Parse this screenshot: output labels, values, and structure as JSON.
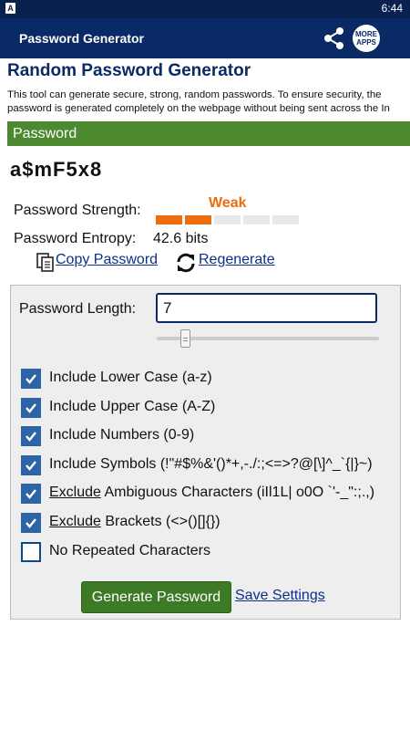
{
  "status_bar": {
    "app_badge": "A",
    "time": "6:44"
  },
  "app_bar": {
    "title": "Password Generator",
    "share_icon": "share-icon",
    "more_apps_label_line1": "MORE",
    "more_apps_label_line2": "APPS"
  },
  "page": {
    "title": "Random Password Generator",
    "intro_line1": "This tool can generate secure, strong, random passwords. To ensure security, the",
    "intro_line2": "password is generated completely on the webpage without being sent across the In"
  },
  "password_section": {
    "header": "Password",
    "password": "a$mF5x8",
    "strength_label": "Password Strength:",
    "strength_text": "Weak",
    "strength_filled_segments": 2,
    "strength_total_segments": 5,
    "strength_color": "#ef6c0d",
    "entropy_label": "Password Entropy:",
    "entropy_value": "42.6 bits",
    "copy_label": "Copy Password",
    "regenerate_label": "Regenerate"
  },
  "settings": {
    "length_label": "Password Length:",
    "length_value": "7",
    "slider_fraction": 0.11,
    "options": [
      {
        "pre": "",
        "underlined": "",
        "text": "Include Lower Case (a-z)",
        "checked": true
      },
      {
        "pre": "",
        "underlined": "",
        "text": "Include Upper Case (A-Z)",
        "checked": true
      },
      {
        "pre": "",
        "underlined": "",
        "text": "Include Numbers (0-9)",
        "checked": true
      },
      {
        "pre": "",
        "underlined": "",
        "text": "Include Symbols (!\"#$%&'()*+,-./:;<=>?@[\\]^_`{|}~)",
        "checked": true
      },
      {
        "pre": "",
        "underlined": "Exclude",
        "text": " Ambiguous Characters (iIl1L| o0O `'-_\":;.,)",
        "checked": true
      },
      {
        "pre": "",
        "underlined": "Exclude",
        "text": " Brackets (<>()[]{})",
        "checked": true
      },
      {
        "pre": "",
        "underlined": "",
        "text": "No Repeated Characters",
        "checked": false
      }
    ],
    "generate_button": "Generate Password",
    "save_link": "Save Settings"
  },
  "colors": {
    "app_bar": "#0a2a66",
    "section_header": "#4d8a2f",
    "button": "#3d7a25",
    "link": "#0a2f8c",
    "checkbox": "#2c64a6"
  }
}
